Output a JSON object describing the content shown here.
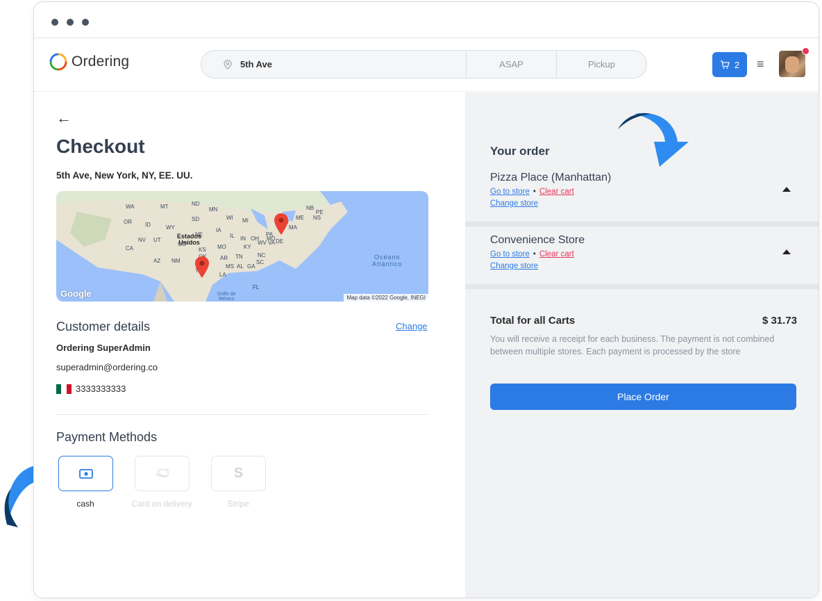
{
  "header": {
    "logo_text": "Ordering",
    "search": {
      "address": "5th Ave",
      "time": "ASAP",
      "mode": "Pickup"
    },
    "cart_count": "2"
  },
  "checkout": {
    "title": "Checkout",
    "address": "5th Ave, New York, NY, EE. UU.",
    "map": {
      "country_label": "Estados\nUnidos",
      "ocean_label": "Océano\nAtlántico",
      "gulf_label": "Golfo de\nMéxico",
      "google_label": "Google",
      "attribution": "Map data ©2022 Google, INEGI",
      "state_labels": [
        "WA",
        "MT",
        "ND",
        "MN",
        "WI",
        "MI",
        "OR",
        "ID",
        "SD",
        "WY",
        "NE",
        "IA",
        "IL",
        "IN",
        "OH",
        "PA",
        "NY",
        "ME",
        "NB",
        "PE",
        "NS",
        "NV",
        "UT",
        "CO",
        "KS",
        "MO",
        "KY",
        "WV",
        "VA",
        "MD",
        "DE",
        "CA",
        "AZ",
        "NM",
        "OK",
        "AR",
        "TN",
        "NC",
        "MS",
        "AL",
        "GA",
        "SC",
        "TX",
        "LA",
        "FL",
        "MA"
      ]
    },
    "customer": {
      "section_title": "Customer details",
      "change_label": "Change",
      "name": "Ordering SuperAdmin",
      "email": "superadmin@ordering.co",
      "phone": "3333333333"
    },
    "payment": {
      "section_title": "Payment Methods",
      "methods": [
        {
          "label": "cash",
          "icon": "cash-icon",
          "active": true
        },
        {
          "label": "Card on delivery",
          "icon": "card-icon",
          "active": false
        },
        {
          "label": "Stripe",
          "icon": "stripe-icon",
          "active": false
        }
      ]
    }
  },
  "order": {
    "title": "Your order",
    "stores": [
      {
        "name": "Pizza Place (Manhattan)",
        "go_to_store": "Go to store",
        "bullet": "•",
        "clear_cart": "Clear cart",
        "change_store": "Change store"
      },
      {
        "name": "Convenience Store",
        "go_to_store": "Go to store",
        "bullet": "•",
        "clear_cart": "Clear cart",
        "change_store": "Change store"
      }
    ],
    "total_label": "Total for all Carts",
    "total_value": "$ 31.73",
    "note": "You will receive a receipt for each business. The payment is not combined between multiple stores. Each payment is processed by the store",
    "place_order": "Place Order"
  },
  "colors": {
    "primary": "#2c7be5",
    "danger": "#e63757",
    "panel": "#f1f2f4",
    "arrow_light": "#2e8cf0",
    "arrow_dark": "#0d3b66"
  }
}
